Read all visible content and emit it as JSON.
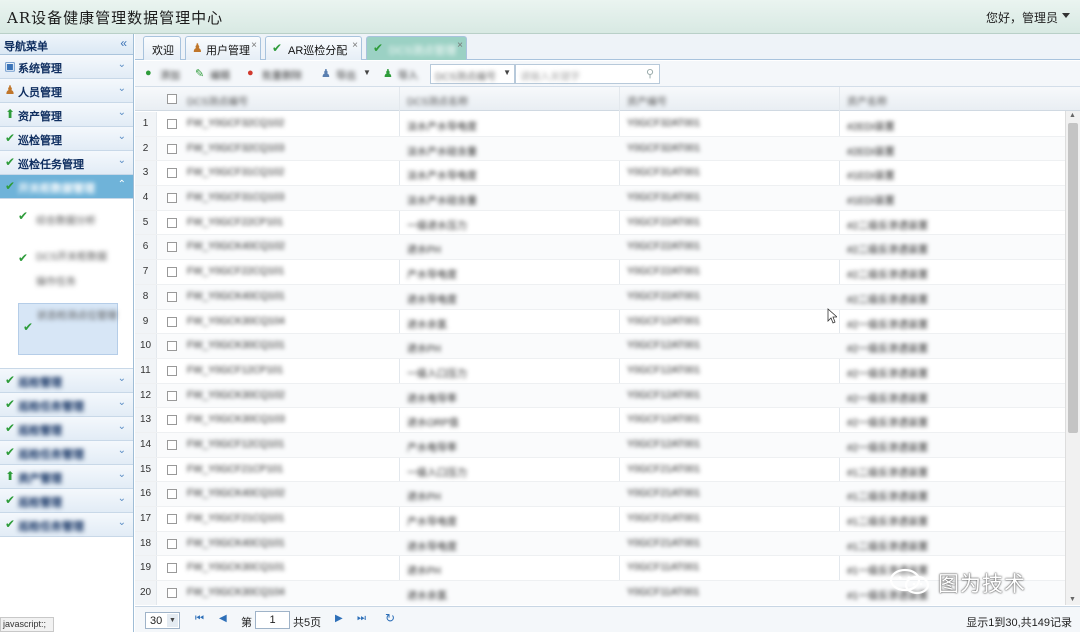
{
  "app": {
    "title": "AR设备健康管理数据管理中心",
    "greeting": "您好，管理员"
  },
  "sidebar": {
    "header": "导航菜单",
    "items": [
      {
        "label": "系统管理",
        "icon": "monitor-icon"
      },
      {
        "label": "人员管理",
        "icon": "users-icon"
      },
      {
        "label": "资产管理",
        "icon": "upload-icon"
      },
      {
        "label": "巡检管理",
        "icon": "check-icon"
      },
      {
        "label": "巡检任务管理",
        "icon": "check-icon"
      },
      {
        "label": "开关柜数据管理",
        "icon": "check-icon"
      }
    ],
    "sub_items": [
      {
        "label": "综合数据分析"
      },
      {
        "label": "DCS开关柜数据操作任务"
      },
      {
        "label": "状态检测点位管理"
      }
    ],
    "lower_items": [
      {
        "label": "巡检管理",
        "icon": "check-icon"
      },
      {
        "label": "巡检任务管理",
        "icon": "check-icon"
      },
      {
        "label": "巡检管理",
        "icon": "check-icon"
      },
      {
        "label": "巡检任务管理",
        "icon": "check-icon"
      },
      {
        "label": "资产管理",
        "icon": "upload-icon"
      },
      {
        "label": "巡检管理",
        "icon": "check-icon"
      },
      {
        "label": "巡检任务管理",
        "icon": "check-icon"
      }
    ]
  },
  "tabs": [
    {
      "label": "欢迎"
    },
    {
      "label": "用户管理"
    },
    {
      "label": "AR巡检分配"
    },
    {
      "label": "DCS测点管理"
    }
  ],
  "toolbar": {
    "add": "添加",
    "edit": "编辑",
    "batch_delete": "批量删除",
    "export": "导出",
    "import": "导入",
    "field_select": "DCS测点编号",
    "search_placeholder": "请输入关键字"
  },
  "grid": {
    "columns": [
      "DCS测点编号",
      "DCS测点名称",
      "资产编号",
      "资产名称"
    ],
    "rows": [
      {
        "n": "1",
        "code": "FW_Y0GCF32CQ102",
        "name": "淡水产水导电度",
        "asset": "Y0GCF32AT001",
        "asset_name": "#2EDI装置"
      },
      {
        "n": "2",
        "code": "FW_Y0GCF32CQ103",
        "name": "淡水产水硅含量",
        "asset": "Y0GCF32AT001",
        "asset_name": "#2EDI装置"
      },
      {
        "n": "3",
        "code": "FW_Y0GCF31CQ102",
        "name": "淡水产水导电度",
        "asset": "Y0GCF31AT001",
        "asset_name": "#1EDI装置"
      },
      {
        "n": "4",
        "code": "FW_Y0GCF31CQ103",
        "name": "淡水产水硅含量",
        "asset": "Y0GCF31AT001",
        "asset_name": "#1EDI装置"
      },
      {
        "n": "5",
        "code": "FW_Y0GCF22CP101",
        "name": "一级进水压力",
        "asset": "Y0GCF22AT001",
        "asset_name": "#2二级反渗透装置"
      },
      {
        "n": "6",
        "code": "FW_Y0GCK40CQ102",
        "name": "进水PH",
        "asset": "Y0GCF22AT001",
        "asset_name": "#2二级反渗透装置"
      },
      {
        "n": "7",
        "code": "FW_Y0GCF22CQ101",
        "name": "产水导电度",
        "asset": "Y0GCF22AT001",
        "asset_name": "#2二级反渗透装置"
      },
      {
        "n": "8",
        "code": "FW_Y0GCK40CQ101",
        "name": "进水导电度",
        "asset": "Y0GCF22AT001",
        "asset_name": "#2二级反渗透装置"
      },
      {
        "n": "9",
        "code": "FW_Y0GCK30CQ104",
        "name": "进水余氯",
        "asset": "Y0GCF12AT001",
        "asset_name": "#2一级反渗透装置"
      },
      {
        "n": "10",
        "code": "FW_Y0GCK30CQ101",
        "name": "进水PH",
        "asset": "Y0GCF12AT001",
        "asset_name": "#2一级反渗透装置"
      },
      {
        "n": "11",
        "code": "FW_Y0GCF12CP101",
        "name": "一级入口压力",
        "asset": "Y0GCF12AT001",
        "asset_name": "#2一级反渗透装置"
      },
      {
        "n": "12",
        "code": "FW_Y0GCK30CQ102",
        "name": "进水电导率",
        "asset": "Y0GCF12AT001",
        "asset_name": "#2一级反渗透装置"
      },
      {
        "n": "13",
        "code": "FW_Y0GCK30CQ103",
        "name": "进水ORP值",
        "asset": "Y0GCF12AT001",
        "asset_name": "#2一级反渗透装置"
      },
      {
        "n": "14",
        "code": "FW_Y0GCF12CQ101",
        "name": "产水电导率",
        "asset": "Y0GCF12AT001",
        "asset_name": "#2一级反渗透装置"
      },
      {
        "n": "15",
        "code": "FW_Y0GCF21CP101",
        "name": "一级入口压力",
        "asset": "Y0GCF21AT001",
        "asset_name": "#1二级反渗透装置"
      },
      {
        "n": "16",
        "code": "FW_Y0GCK40CQ102",
        "name": "进水PH",
        "asset": "Y0GCF21AT001",
        "asset_name": "#1二级反渗透装置"
      },
      {
        "n": "17",
        "code": "FW_Y0GCF21CQ101",
        "name": "产水导电度",
        "asset": "Y0GCF21AT001",
        "asset_name": "#1二级反渗透装置"
      },
      {
        "n": "18",
        "code": "FW_Y0GCK40CQ101",
        "name": "进水导电度",
        "asset": "Y0GCF21AT001",
        "asset_name": "#1二级反渗透装置"
      },
      {
        "n": "19",
        "code": "FW_Y0GCK30CQ101",
        "name": "进水PH",
        "asset": "Y0GCF11AT001",
        "asset_name": "#1一级反渗透装置"
      },
      {
        "n": "20",
        "code": "FW_Y0GCK30CQ104",
        "name": "进水余氯",
        "asset": "Y0GCF11AT001",
        "asset_name": "#1一级反渗透装置"
      }
    ]
  },
  "pager": {
    "page_size": "30",
    "page_prefix": "第",
    "page_value": "1",
    "page_suffix": "共5页",
    "info": "显示1到30,共149记录"
  },
  "statusbar": "javascript:;",
  "watermark": {
    "text": "图为技术"
  },
  "colors": {
    "check": "#2e9c3a",
    "active_menu": "#6fb3d9",
    "active_tab": "#9bd1c4",
    "link": "#2d6fb8"
  }
}
